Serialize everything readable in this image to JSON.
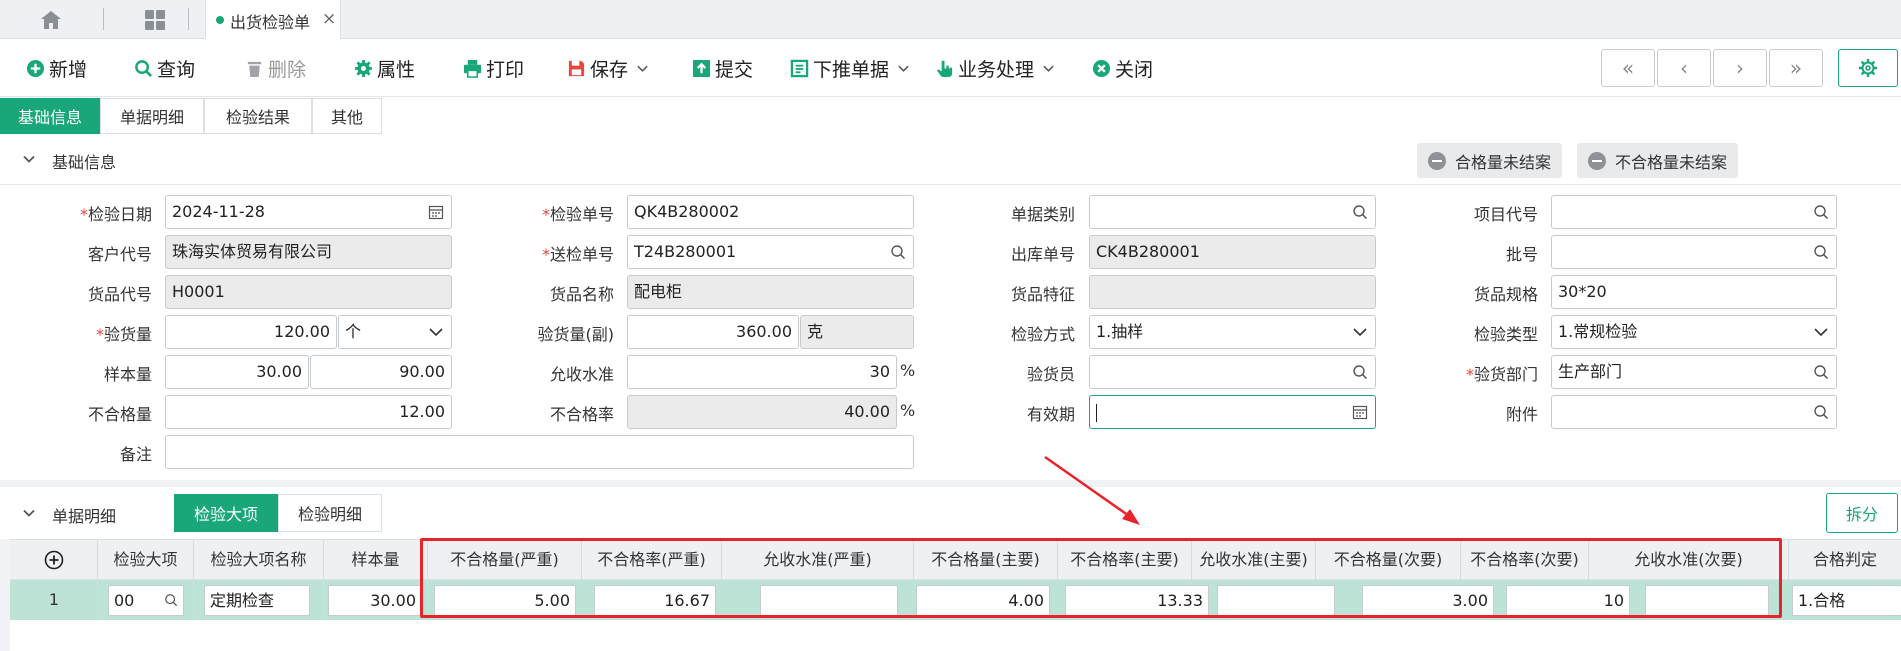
{
  "tabbar": {
    "tab_label": "出货检验单",
    "close": "×"
  },
  "toolbar": {
    "new": "新增",
    "query": "查询",
    "delete": "删除",
    "props": "属性",
    "print": "打印",
    "save": "保存",
    "submit": "提交",
    "push": "下推单据",
    "business": "业务处理",
    "close": "关闭",
    "nav_first": "«",
    "nav_prev": "‹",
    "nav_next": "›",
    "nav_last": "»"
  },
  "page_tabs": [
    "基础信息",
    "单据明细",
    "检验结果",
    "其他"
  ],
  "basic_section": {
    "title": "基础信息",
    "btn_pass": "合格量未结案",
    "btn_fail": "不合格量未结案"
  },
  "form": {
    "inspect_date": {
      "label": "检验日期",
      "value": "2024-11-28"
    },
    "inspect_no": {
      "label": "检验单号",
      "value": "QK4B280002"
    },
    "doc_type": {
      "label": "单据类别",
      "value": ""
    },
    "project_code": {
      "label": "项目代号",
      "value": ""
    },
    "customer_code": {
      "label": "客户代号",
      "value": "珠海实体贸易有限公司"
    },
    "submit_no": {
      "label": "送检单号",
      "value": "T24B280001"
    },
    "outbound_no": {
      "label": "出库单号",
      "value": "CK4B280001"
    },
    "batch_no": {
      "label": "批号",
      "value": ""
    },
    "goods_code": {
      "label": "货品代号",
      "value": "H0001"
    },
    "goods_name": {
      "label": "货品名称",
      "value": "配电柜"
    },
    "goods_feature": {
      "label": "货品特征",
      "value": ""
    },
    "goods_spec": {
      "label": "货品规格",
      "value": "30*20"
    },
    "inspect_qty": {
      "label": "验货量",
      "value": "120.00",
      "unit": "个"
    },
    "inspect_qty2": {
      "label": "验货量(副)",
      "value": "360.00",
      "unit": "克"
    },
    "inspect_method": {
      "label": "检验方式",
      "value": "1.抽样"
    },
    "inspect_type": {
      "label": "检验类型",
      "value": "1.常规检验"
    },
    "sample_qty": {
      "label": "样本量",
      "value": "30.00",
      "value2": "90.00"
    },
    "aql": {
      "label": "允收水准",
      "value": "30",
      "unit": "%"
    },
    "inspector": {
      "label": "验货员",
      "value": ""
    },
    "dept": {
      "label": "验货部门",
      "value": "生产部门"
    },
    "defect_qty": {
      "label": "不合格量",
      "value": "12.00"
    },
    "defect_rate": {
      "label": "不合格率",
      "value": "40.00",
      "unit": "%"
    },
    "valid_period": {
      "label": "有效期",
      "value": ""
    },
    "attachment": {
      "label": "附件",
      "value": ""
    },
    "remark": {
      "label": "备注",
      "value": ""
    }
  },
  "detail": {
    "title": "单据明细",
    "tabs": [
      "检验大项",
      "检验明细"
    ],
    "split_btn": "拆分",
    "columns": [
      "检验大项",
      "检验大项名称",
      "样本量",
      "不合格量(严重)",
      "不合格率(严重)",
      "允收水准(严重)",
      "不合格量(主要)",
      "不合格率(主要)",
      "允收水准(主要)",
      "不合格量(次要)",
      "不合格率(次要)",
      "允收水准(次要)",
      "合格判定"
    ],
    "row": {
      "no": "1",
      "item": "00",
      "item_name": "定期检查",
      "sample": "30.00",
      "defect_severe": "5.00",
      "rate_severe": "16.67",
      "aql_severe": "",
      "defect_major": "4.00",
      "rate_major": "13.33",
      "aql_major": "",
      "defect_minor": "3.00",
      "rate_minor": "10",
      "aql_minor": "",
      "judge": "1.合格"
    }
  },
  "colors": {
    "accent": "#19a779",
    "highlight": "#e8242a",
    "row_selected": "#bde2d6"
  }
}
